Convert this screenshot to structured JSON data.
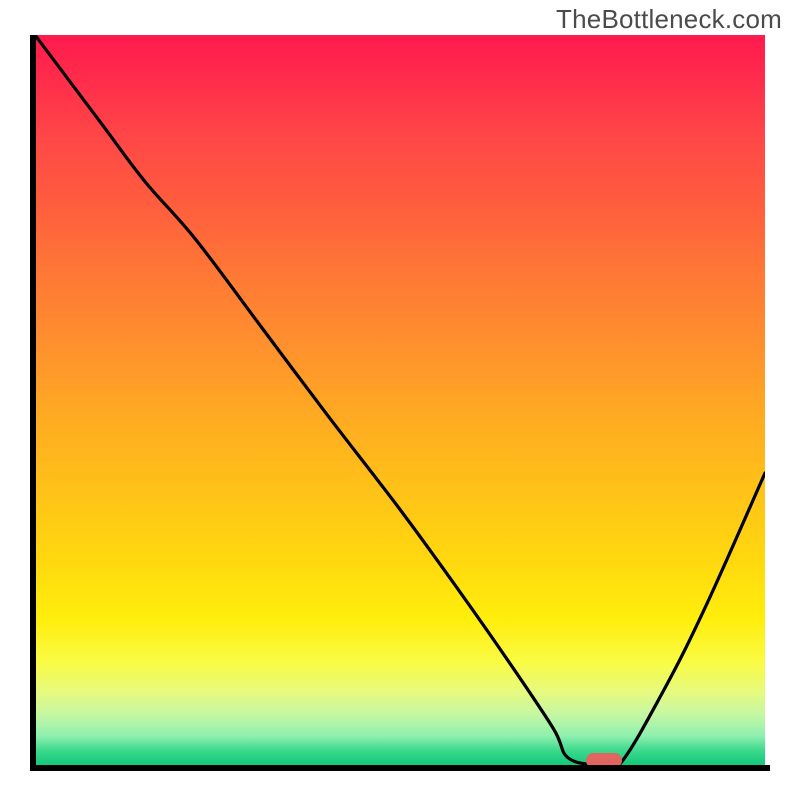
{
  "watermark": "TheBottleneck.com",
  "marker_color": "#e0645f",
  "gradient_stops": [
    {
      "offset": 0,
      "color": "#ff1a4d"
    },
    {
      "offset": 50,
      "color": "#ffaa22"
    },
    {
      "offset": 80,
      "color": "#ffee0c"
    },
    {
      "offset": 100,
      "color": "#12c97a"
    }
  ],
  "chart_data": {
    "type": "line",
    "title": "",
    "xlabel": "",
    "ylabel": "",
    "xlim": [
      0,
      100
    ],
    "ylim": [
      0,
      100
    ],
    "grid": false,
    "series": [
      {
        "name": "bottleneck-curve",
        "x": [
          0,
          9,
          15,
          22,
          31,
          40,
          50,
          58,
          65,
          71,
          73,
          77,
          80,
          86,
          92,
          100
        ],
        "y": [
          100,
          88,
          80,
          72,
          60,
          48,
          35,
          24,
          14,
          5,
          1,
          0,
          0,
          10,
          22,
          40
        ]
      }
    ],
    "marker": {
      "x": 78,
      "y": 0.5
    },
    "legend": false
  }
}
